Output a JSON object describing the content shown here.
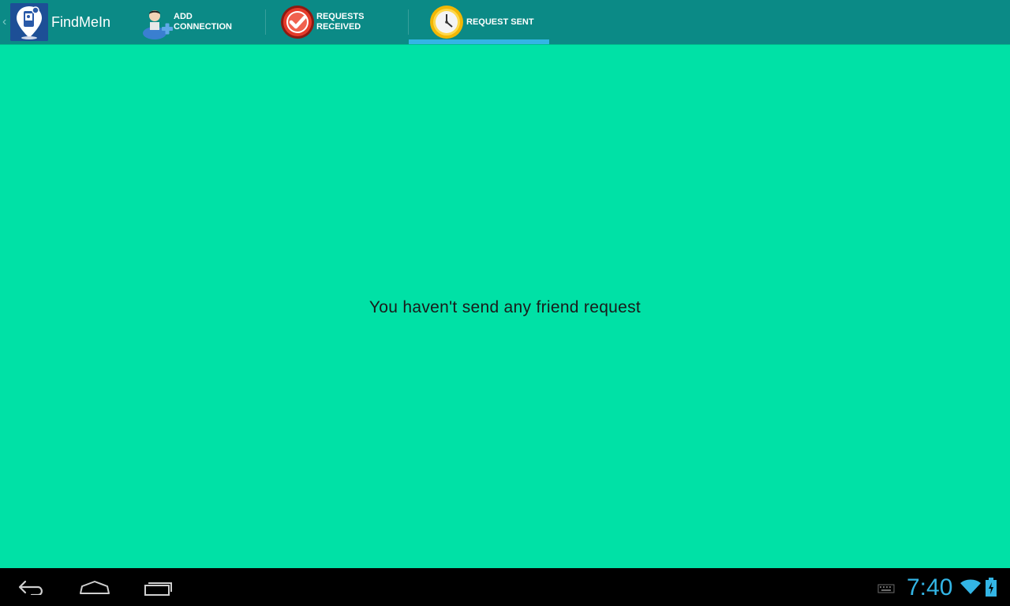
{
  "app": {
    "title": "FindMeIn",
    "up_caret": "‹"
  },
  "tabs": [
    {
      "line1": "ADD",
      "line2": "CONNECTION",
      "icon": "add-person-icon"
    },
    {
      "line1": "REQUESTS",
      "line2": "RECEIVED",
      "icon": "check-circle-icon"
    },
    {
      "line1": "REQUEST SENT",
      "icon": "clock-icon",
      "selected": true
    }
  ],
  "main": {
    "empty_message": "You haven't send any friend request"
  },
  "system_bar": {
    "time": "7:40",
    "icons": [
      "back-icon",
      "home-icon",
      "recents-icon",
      "keyboard-icon",
      "wifi-icon",
      "battery-charging-icon"
    ]
  },
  "colors": {
    "action_bar": "#0b8a86",
    "background": "#00e1a6",
    "tab_indicator": "#33b5e5",
    "clock": "#33b5e5"
  }
}
